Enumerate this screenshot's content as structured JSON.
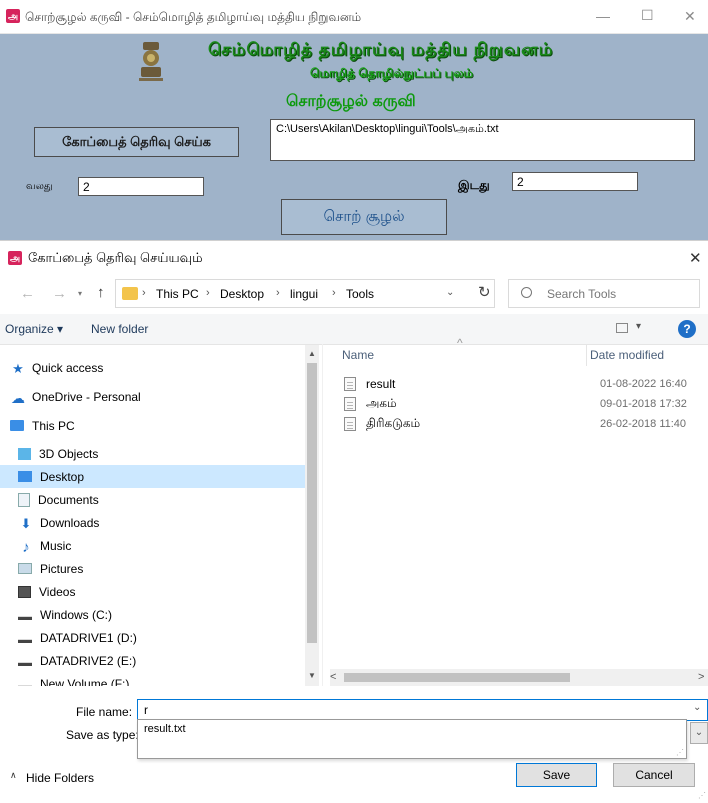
{
  "app": {
    "title": "சொற்சூழல் கருவி - செம்மொழித் தமிழாய்வு மத்திய நிறுவனம்",
    "banner_line1": "செம்மொழித் தமிழாய்வு மத்திய நிறுவனம்",
    "banner_line2": "மொழித் தொழில்நுட்பப் புலம்",
    "banner_line3": "சொற்சூழல் கருவி",
    "select_file_button": "கோப்பைத் தெரிவு செய்க",
    "file_path": "C:\\Users\\Akilan\\Desktop\\lingui\\Tools\\அகம்.txt",
    "right_label": "வலது",
    "right_value": "2",
    "left_label": "இடது",
    "left_value": "2",
    "search_button": "சொற் சூழல்",
    "window_controls": {
      "minimize": "—",
      "maximize": "☐",
      "close": "✕"
    }
  },
  "dialog": {
    "title": "கோப்பைத் தெரிவு செய்யவும்",
    "close": "✕",
    "nav_back": "←",
    "nav_forward": "→",
    "nav_up": "↑",
    "breadcrumb": [
      "This PC",
      "Desktop",
      "lingui",
      "Tools"
    ],
    "breadcrumb_sep": "›",
    "refresh": "↻",
    "search_placeholder": "Search Tools",
    "organize": "Organize ▾",
    "new_folder": "New folder",
    "help": "?",
    "sidebar": [
      {
        "label": "Quick access",
        "icon": "star-icon"
      },
      {
        "label": "OneDrive - Personal",
        "icon": "cloud-icon"
      },
      {
        "label": "This PC",
        "icon": "monitor-icon"
      },
      {
        "label": "3D Objects",
        "icon": "cube-icon"
      },
      {
        "label": "Desktop",
        "icon": "desktop-icon",
        "selected": true
      },
      {
        "label": "Documents",
        "icon": "document-icon"
      },
      {
        "label": "Downloads",
        "icon": "download-icon"
      },
      {
        "label": "Music",
        "icon": "music-icon"
      },
      {
        "label": "Pictures",
        "icon": "picture-icon"
      },
      {
        "label": "Videos",
        "icon": "video-icon"
      },
      {
        "label": "Windows (C:)",
        "icon": "drive-icon"
      },
      {
        "label": "DATADRIVE1 (D:)",
        "icon": "drive-icon"
      },
      {
        "label": "DATADRIVE2 (E:)",
        "icon": "drive-icon"
      },
      {
        "label": "New Volume (F:)",
        "icon": "drive-icon"
      }
    ],
    "columns": {
      "name": "Name",
      "date": "Date modified"
    },
    "files": [
      {
        "name": "result",
        "date": "01-08-2022 16:40"
      },
      {
        "name": "அகம்",
        "date": "09-01-2018 17:32"
      },
      {
        "name": "திரிகடுகம்",
        "date": "26-02-2018 11:40"
      }
    ],
    "file_name_label": "File name:",
    "file_name_value": "r",
    "save_as_type_label": "Save as type:",
    "autocomplete": "result.txt",
    "hide_folders": "Hide Folders",
    "save": "Save",
    "cancel": "Cancel"
  },
  "colors": {
    "app_bg": "#9fb3c9",
    "selected": "#cce8ff",
    "accent": "#0078d7",
    "tamil_green": "#1a8a1a"
  }
}
